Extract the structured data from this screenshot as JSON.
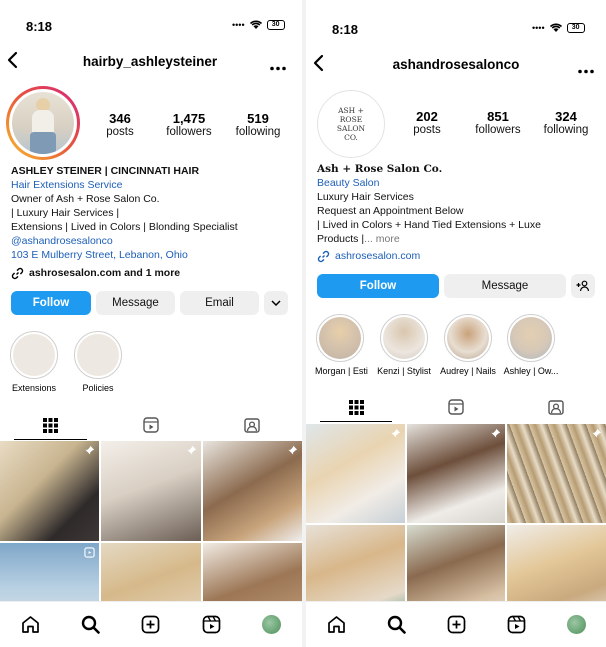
{
  "left": {
    "status": {
      "time": "8:18",
      "battery": "30"
    },
    "header": {
      "title": "hairby_ashleysteiner"
    },
    "stats": [
      {
        "value": "346",
        "label": "posts"
      },
      {
        "value": "1,475",
        "label": "followers"
      },
      {
        "value": "519",
        "label": "following"
      }
    ],
    "bio": {
      "name": "ASHLEY STEINER | CINCINNATI HAIR",
      "category": "Hair Extensions Service",
      "lines": [
        "Owner of Ash + Rose Salon Co.",
        "| Luxury Hair Services |",
        "Extensions | Lived in Colors | Blonding Specialist"
      ],
      "mention": "@ashandrosesalonco",
      "address": "103 E Mulberry Street, Lebanon, Ohio",
      "link": "ashrosesalon.com and 1 more"
    },
    "buttons": {
      "follow": "Follow",
      "message": "Message",
      "email": "Email"
    },
    "highlights": [
      {
        "label": "Extensions"
      },
      {
        "label": "Policies"
      }
    ],
    "colors": {
      "ring_start": "#f9c02d",
      "ring_end": "#d6247c"
    }
  },
  "right": {
    "status": {
      "time": "8:18",
      "battery": "30"
    },
    "header": {
      "title": "ashandrosesalonco"
    },
    "avatar_text": "ASH + ROSE SALON CO.",
    "stats": [
      {
        "value": "202",
        "label": "posts"
      },
      {
        "value": "851",
        "label": "followers"
      },
      {
        "value": "324",
        "label": "following"
      }
    ],
    "bio": {
      "name": "Ash + Rose Salon Co.",
      "category": "Beauty Salon",
      "lines": [
        "Luxury Hair Services",
        "Request an Appointment Below",
        "| Lived in Colors + Hand Tied Extensions + Luxe"
      ],
      "last_line": "Products |",
      "more": "... more",
      "link": "ashrosesalon.com"
    },
    "buttons": {
      "follow": "Follow",
      "message": "Message"
    },
    "highlights": [
      {
        "label": "Morgan | Esti"
      },
      {
        "label": "Kenzi | Stylist"
      },
      {
        "label": "Audrey | Nails"
      },
      {
        "label": "Ashley | Ow..."
      }
    ]
  },
  "icons": {
    "back": "chevron-left-icon",
    "more": "more-horizontal-icon",
    "grid": "grid-icon",
    "reels": "reels-icon",
    "tagged": "tagged-icon",
    "home": "home-icon",
    "search": "search-icon",
    "create": "create-icon",
    "profile": "profile-avatar-icon"
  },
  "brand": {
    "accent": "#1e9bf0",
    "link": "#1d5fb8"
  }
}
